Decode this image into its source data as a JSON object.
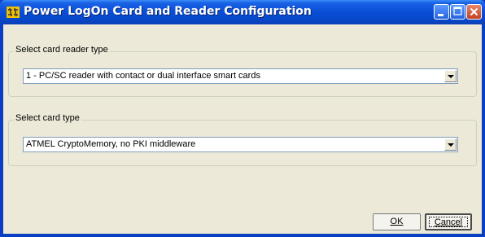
{
  "window": {
    "title": "Power LogOn Card and Reader Configuration",
    "controls": [
      "minimize-icon",
      "maximize-icon",
      "close-icon"
    ]
  },
  "reader_group": {
    "label": "Select card reader type",
    "selected": "1 - PC/SC reader with contact or dual interface smart cards"
  },
  "card_group": {
    "label": "Select card type",
    "selected": "ATMEL CryptoMemory, no PKI middleware"
  },
  "buttons": {
    "ok": "OK",
    "cancel": "Cancel"
  },
  "colors": {
    "titlebar": "#0a50d8",
    "client": "#ece9d8",
    "close": "#c5401f"
  }
}
